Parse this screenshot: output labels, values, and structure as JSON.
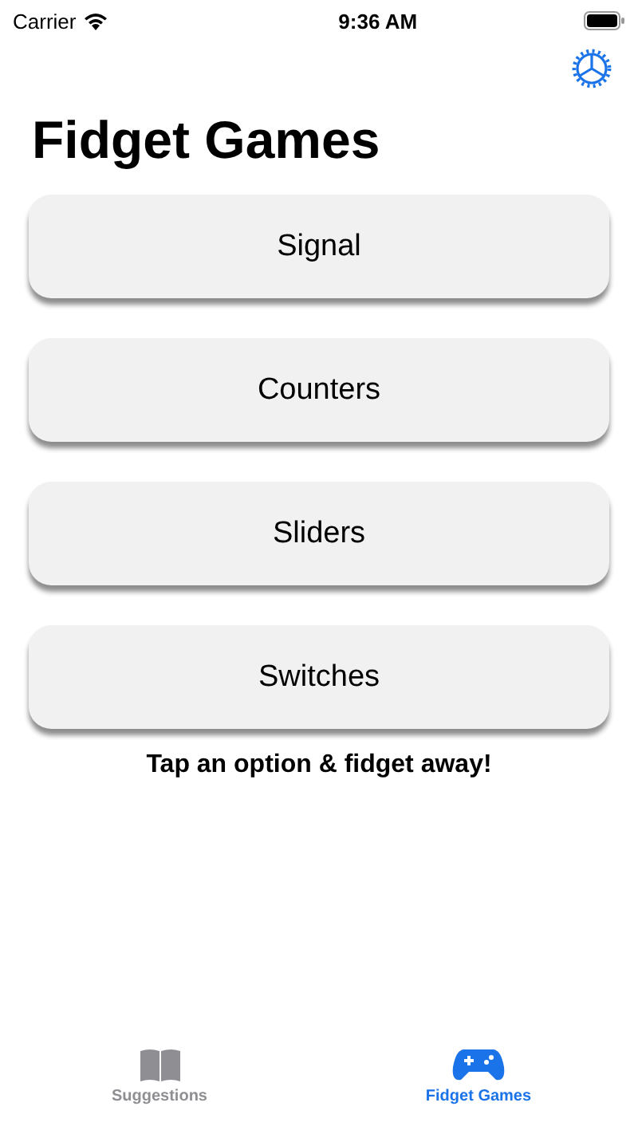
{
  "status_bar": {
    "carrier": "Carrier",
    "time": "9:36 AM"
  },
  "title": "Fidget Games",
  "options": [
    {
      "label": "Signal"
    },
    {
      "label": "Counters"
    },
    {
      "label": "Sliders"
    },
    {
      "label": "Switches"
    }
  ],
  "caption": "Tap an option & fidget away!",
  "tab_bar": [
    {
      "label": "Suggestions",
      "kind": "book",
      "selected": false
    },
    {
      "label": "Fidget Games",
      "kind": "gamepad",
      "selected": true
    }
  ]
}
